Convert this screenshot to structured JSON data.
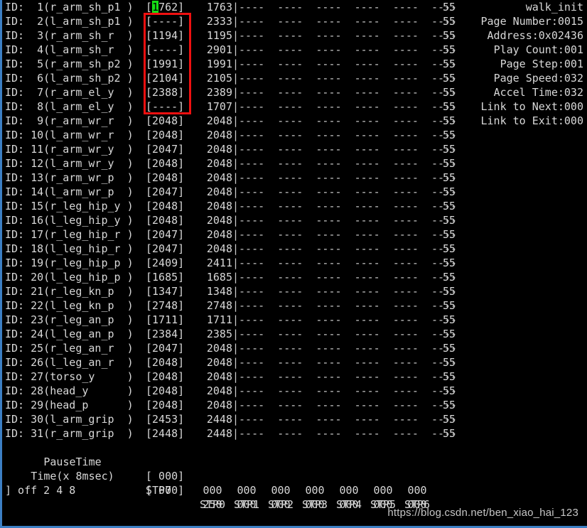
{
  "terminal": {
    "background_color": "#000000",
    "text_color": "#d8d8d8",
    "border_color": "#3c7fc4",
    "cursor_color": "#15e015",
    "annotation_color": "#f01010"
  },
  "table": {
    "id_prefix": "ID:",
    "bar_dashes": "----  ----  ----  ----  ----  ----",
    "flag_value": "55",
    "rows": [
      {
        "id": "1",
        "name": "r_arm_sh_p1",
        "goal": "1762",
        "present": "1763",
        "cursor_digit": "1",
        "cursor_rest": "762"
      },
      {
        "id": "2",
        "name": "l_arm_sh_p1",
        "goal": "----",
        "present": "2333"
      },
      {
        "id": "3",
        "name": "r_arm_sh_r",
        "goal": "1194",
        "present": "1195"
      },
      {
        "id": "4",
        "name": "l_arm_sh_r",
        "goal": "----",
        "present": "2901"
      },
      {
        "id": "5",
        "name": "r_arm_sh_p2",
        "goal": "1991",
        "present": "1991"
      },
      {
        "id": "6",
        "name": "l_arm_sh_p2",
        "goal": "2104",
        "present": "2105"
      },
      {
        "id": "7",
        "name": "r_arm_el_y",
        "goal": "2388",
        "present": "2389"
      },
      {
        "id": "8",
        "name": "l_arm_el_y",
        "goal": "----",
        "present": "1707"
      },
      {
        "id": "9",
        "name": "r_arm_wr_r",
        "goal": "2048",
        "present": "2048"
      },
      {
        "id": "10",
        "name": "l_arm_wr_r",
        "goal": "2048",
        "present": "2048"
      },
      {
        "id": "11",
        "name": "r_arm_wr_y",
        "goal": "2047",
        "present": "2048"
      },
      {
        "id": "12",
        "name": "l_arm_wr_y",
        "goal": "2048",
        "present": "2048"
      },
      {
        "id": "13",
        "name": "r_arm_wr_p",
        "goal": "2048",
        "present": "2048"
      },
      {
        "id": "14",
        "name": "l_arm_wr_p",
        "goal": "2047",
        "present": "2048"
      },
      {
        "id": "15",
        "name": "r_leg_hip_y",
        "goal": "2048",
        "present": "2048"
      },
      {
        "id": "16",
        "name": "l_leg_hip_y",
        "goal": "2048",
        "present": "2048"
      },
      {
        "id": "17",
        "name": "r_leg_hip_r",
        "goal": "2047",
        "present": "2048"
      },
      {
        "id": "18",
        "name": "l_leg_hip_r",
        "goal": "2047",
        "present": "2048"
      },
      {
        "id": "19",
        "name": "r_leg_hip_p",
        "goal": "2409",
        "present": "2411"
      },
      {
        "id": "20",
        "name": "l_leg_hip_p",
        "goal": "1685",
        "present": "1685"
      },
      {
        "id": "21",
        "name": "r_leg_kn_p",
        "goal": "1347",
        "present": "1348"
      },
      {
        "id": "22",
        "name": "l_leg_kn_p",
        "goal": "2748",
        "present": "2748"
      },
      {
        "id": "23",
        "name": "r_leg_an_p",
        "goal": "1711",
        "present": "1711"
      },
      {
        "id": "24",
        "name": "l_leg_an_p",
        "goal": "2384",
        "present": "2385"
      },
      {
        "id": "25",
        "name": "r_leg_an_r",
        "goal": "2047",
        "present": "2048"
      },
      {
        "id": "26",
        "name": "l_leg_an_r",
        "goal": "2048",
        "present": "2048"
      },
      {
        "id": "27",
        "name": "torso_y",
        "goal": "2048",
        "present": "2048"
      },
      {
        "id": "28",
        "name": "head_y",
        "goal": "2048",
        "present": "2048"
      },
      {
        "id": "29",
        "name": "head_p",
        "goal": "2048",
        "present": "2048"
      },
      {
        "id": "30",
        "name": "l_arm_grip",
        "goal": "2453",
        "present": "2448"
      },
      {
        "id": "31",
        "name": "r_arm_grip",
        "goal": "2448",
        "present": "2448"
      }
    ]
  },
  "info_panel": {
    "lines": [
      "walk_init",
      "Page Number:0015",
      "Address:0x02436",
      "Play Count:001",
      "Page Step:001",
      "Page Speed:032",
      "Accel Time:032",
      "Link to Next:000",
      "Link to Exit:000"
    ]
  },
  "footer": {
    "pause_time": {
      "label": "PauseTime",
      "bracket": "[ 000]",
      "values": [
        "000",
        "000",
        "000",
        "000",
        "000",
        "000",
        "000"
      ]
    },
    "time": {
      "label": "Time(x 8msec)",
      "bracket": "[ 000]",
      "values": [
        "250",
        "000",
        "000",
        "000",
        "000",
        "000",
        "000"
      ]
    },
    "steps": {
      "current": "STP7",
      "labels": [
        "STP0",
        "STP1",
        "STP2",
        "STP3",
        "STP4",
        "STP5",
        "STP6"
      ]
    }
  },
  "prompt": {
    "text": "] off 2 4 8"
  },
  "watermark": {
    "text": "https://blog.csdn.net/ben_xiao_hai_123"
  }
}
